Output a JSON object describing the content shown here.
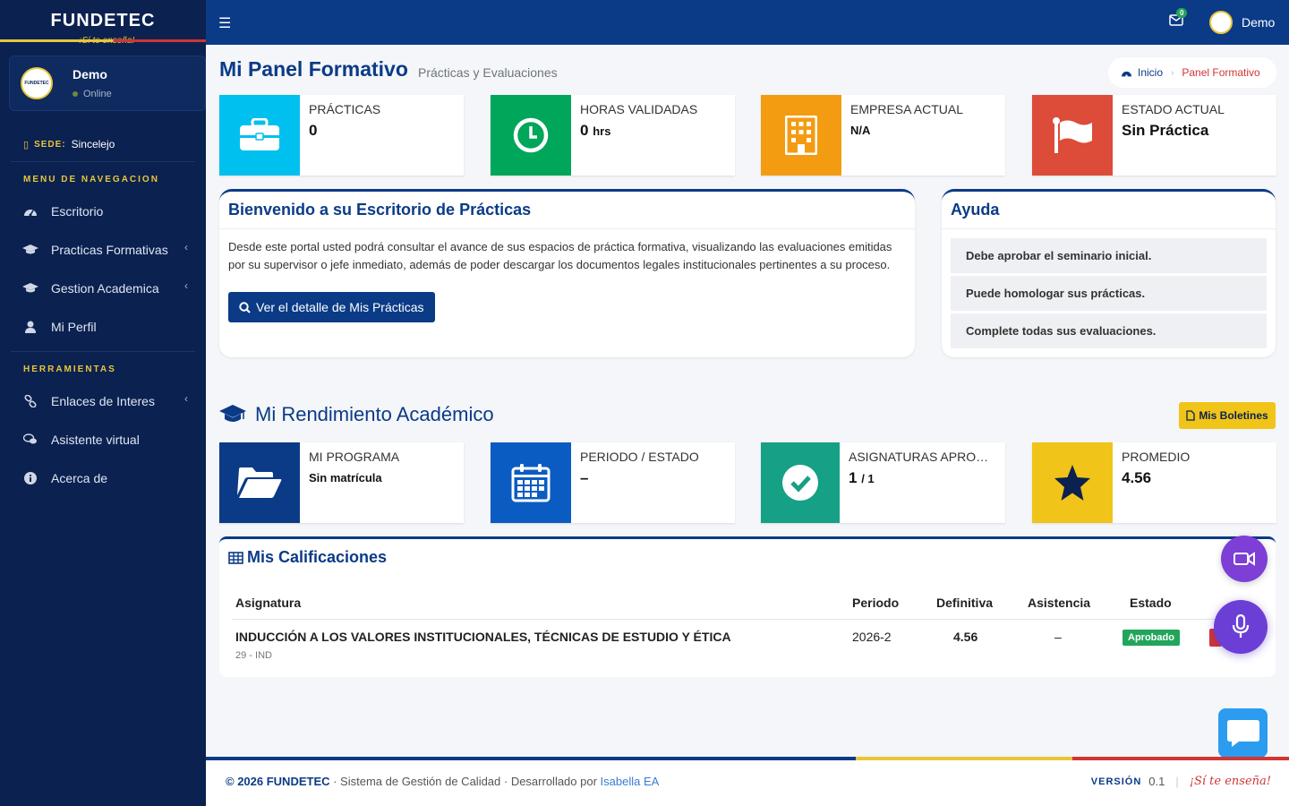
{
  "brand": {
    "name": "FUNDETEC",
    "slogan": "¡Sí te enseña!"
  },
  "user": {
    "name": "Demo",
    "status": "Online",
    "avatar_text": "FUNDETEC"
  },
  "sede": {
    "label": "SEDE:",
    "value": "Sincelejo"
  },
  "sidebar": {
    "header_nav": "MENU DE NAVEGACION",
    "nav_items": [
      {
        "label": "Escritorio",
        "icon": "dashboard-icon"
      },
      {
        "label": "Practicas Formativas",
        "icon": "graduation-cap-icon",
        "chevron": "‹"
      },
      {
        "label": "Gestion Academica",
        "icon": "graduation-cap-icon",
        "chevron": "‹"
      },
      {
        "label": "Mi Perfil",
        "icon": "user-icon"
      }
    ],
    "header_tools": "HERRAMIENTAS",
    "tool_items": [
      {
        "label": "Enlaces de Interes",
        "icon": "link-icon",
        "chevron": "‹"
      },
      {
        "label": "Asistente virtual",
        "icon": "chat-bubbles-icon"
      },
      {
        "label": "Acerca de",
        "icon": "info-icon"
      }
    ]
  },
  "topbar": {
    "mail_count": "0",
    "user_name": "Demo"
  },
  "page": {
    "title": "Mi Panel Formativo",
    "subtitle": "Prácticas y Evaluaciones"
  },
  "breadcrumb": {
    "home": "Inicio",
    "current": "Panel Formativo"
  },
  "stats_top": [
    {
      "label": "PRÁCTICAS",
      "value": "0",
      "color": "#00c0ef",
      "icon": "briefcase-icon"
    },
    {
      "label": "HORAS VALIDADAS",
      "value": "0",
      "unit": "hrs",
      "color": "#00a65a",
      "icon": "clock-icon"
    },
    {
      "label": "EMPRESA ACTUAL",
      "value": "N/A",
      "color": "#f39c12",
      "icon": "building-icon"
    },
    {
      "label": "ESTADO ACTUAL",
      "value": "Sin Práctica",
      "color": "#dd4b39",
      "icon": "flag-icon"
    }
  ],
  "welcome": {
    "title": "Bienvenido a su Escritorio de Prácticas",
    "text": "Desde este portal usted podrá consultar el avance de sus espacios de práctica formativa, visualizando las evaluaciones emitidas por su supervisor o jefe inmediato, además de poder descargar los documentos legales institucionales pertinentes a su proceso.",
    "button": "Ver el detalle de Mis Prácticas"
  },
  "help": {
    "title": "Ayuda",
    "items": [
      "Debe aprobar el seminario inicial.",
      "Puede homologar sus prácticas.",
      "Complete todas sus evaluaciones."
    ]
  },
  "academic": {
    "title": "Mi Rendimiento Académico",
    "button": "Mis Boletines"
  },
  "stats_academic": [
    {
      "label": "MI PROGRAMA",
      "value": "Sin matrícula",
      "color": "#0b3b86",
      "icon": "folder-open-icon"
    },
    {
      "label": "PERIODO / ESTADO",
      "value": "–",
      "color": "#0b5cc2",
      "icon": "calendar-icon"
    },
    {
      "label": "ASIGNATURAS APROBADAS",
      "value": "1",
      "value_suffix": "/ 1",
      "color": "#16a085",
      "icon": "check-circle-icon"
    },
    {
      "label": "PROMEDIO",
      "value": "4.56",
      "color": "#f0c419",
      "icon": "star-icon"
    }
  ],
  "grades": {
    "title": "Mis Calificaciones",
    "headers": {
      "subject": "Asignatura",
      "period": "Periodo",
      "final": "Definitiva",
      "attendance": "Asistencia",
      "status": "Estado"
    },
    "rows": [
      {
        "subject": "INDUCCIÓN A LOS VALORES INSTITUCIONALES, TÉCNICAS DE ESTUDIO Y ÉTICA",
        "code": "29 - IND",
        "period": "2026-2",
        "final": "4.56",
        "attendance": "–",
        "status": "Aprobado"
      }
    ]
  },
  "footer": {
    "copyright": "© 2026 FUNDETEC",
    "text": " · Sistema de Gestión de Calidad · Desarrollado por ",
    "link": "Isabella EA",
    "version_label": "VERSIÓN",
    "version": "0.1",
    "slogan": "¡Sí te enseña!"
  },
  "colors": {
    "primary": "#0b3b86",
    "sidebar": "#0b2150",
    "accent_yellow": "#e8c63a",
    "accent_red": "#d13535"
  }
}
